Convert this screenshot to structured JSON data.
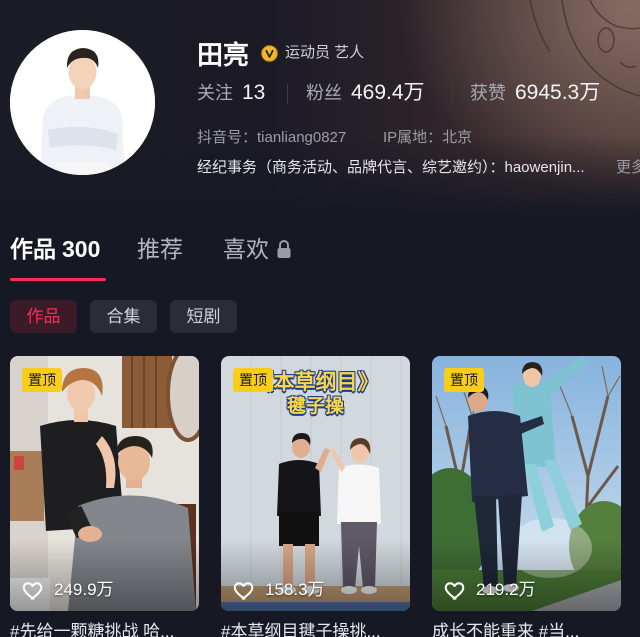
{
  "profile": {
    "name": "田亮",
    "verified_icon": "verified-v-icon",
    "tags": "运动员 艺人",
    "stats": [
      {
        "label": "关注",
        "value": "13"
      },
      {
        "label": "粉丝",
        "value": "469.4万"
      },
      {
        "label": "获赞",
        "value": "6945.3万"
      }
    ],
    "douyin_id": "抖音号：tianliang0827",
    "ip_location": "IP属地：北京",
    "bio": "经纪事务（商务活动、品牌代言、综艺邀约）：haowenjin...",
    "more_label": "更多"
  },
  "tabs": [
    {
      "label": "作品",
      "count": "300",
      "active": true
    },
    {
      "label": "推荐",
      "active": false
    },
    {
      "label": "喜欢",
      "active": false,
      "icon": "lock-icon"
    }
  ],
  "sub_tabs": [
    {
      "label": "作品",
      "active": true
    },
    {
      "label": "合集",
      "active": false
    },
    {
      "label": "短剧",
      "active": false
    }
  ],
  "videos": [
    {
      "pinned_label": "置顶",
      "like_icon": "heart-icon",
      "likes": "249.9万",
      "caption": "#先给一颗糖挑战 哈..."
    },
    {
      "pinned_label": "置顶",
      "like_icon": "heart-icon",
      "likes": "158.3万",
      "caption": "#本草纲目毽子操挑...",
      "overlay": {
        "title": "《本草纲目》",
        "subtitle": "毽子操"
      }
    },
    {
      "pinned_label": "置顶",
      "like_icon": "heart-icon",
      "likes": "219.2万",
      "caption": "成长不能重来 #当..."
    }
  ],
  "colors": {
    "background": "#161823",
    "accent": "#fe2c55",
    "pinned_badge": "#facd1a",
    "verified_badge": "#f0b72f"
  }
}
